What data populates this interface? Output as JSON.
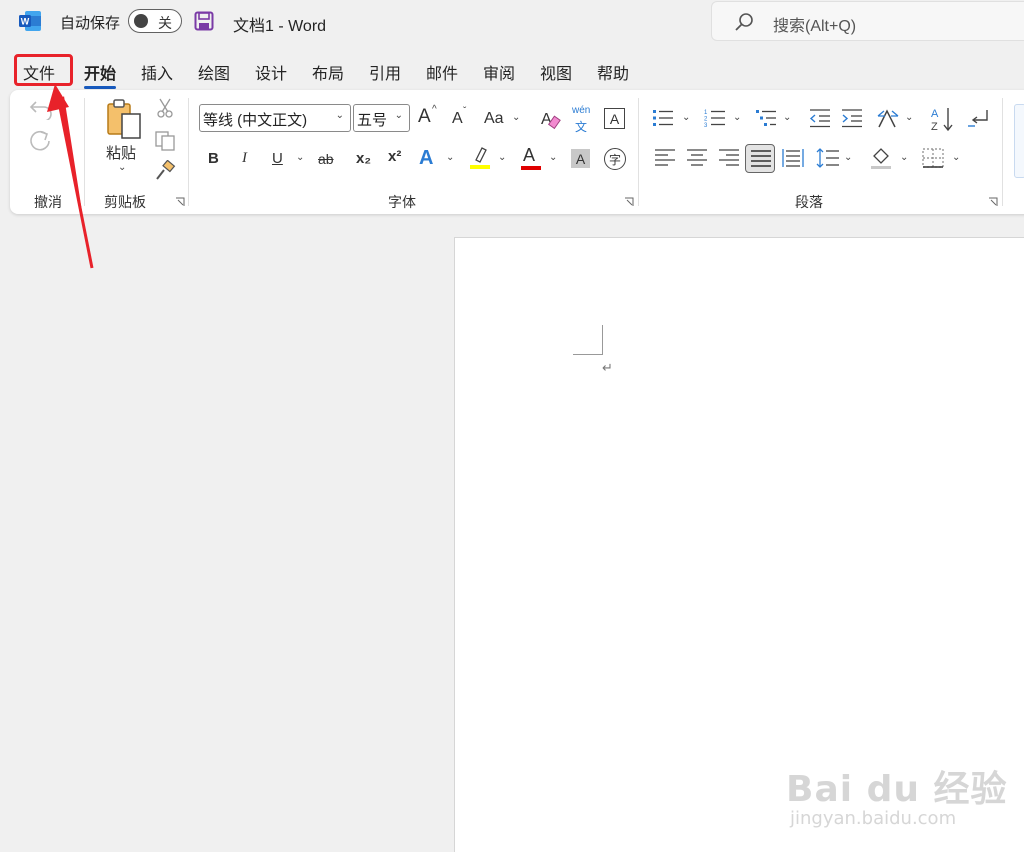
{
  "titlebar": {
    "autosave_label": "自动保存",
    "autosave_state": "关",
    "doc_title": "文档1  -  Word",
    "search_placeholder": "搜索(Alt+Q)"
  },
  "tabs": [
    "文件",
    "开始",
    "插入",
    "绘图",
    "设计",
    "布局",
    "引用",
    "邮件",
    "审阅",
    "视图",
    "帮助"
  ],
  "active_tab": "开始",
  "highlighted_tab": "文件",
  "ribbon": {
    "undo_group_label": "撤消",
    "clipboard": {
      "paste_label": "粘贴",
      "group_label": "剪贴板"
    },
    "font": {
      "font_name": "等线 (中文正文)",
      "font_size": "五号",
      "group_label": "字体",
      "bold": "B",
      "italic": "I",
      "underline": "U",
      "strike": "ab",
      "subscript": "x₂",
      "superscript": "x²",
      "case": "Aa",
      "grow": "A",
      "shrink": "A",
      "effects": "A",
      "phonetic_top": "wén",
      "phonetic_bottom": "文",
      "border_char": "A",
      "shading_char": "A",
      "enclose_char": "字",
      "highlight_color": "#ffff00",
      "font_color": "#e00000"
    },
    "paragraph": {
      "group_label": "段落",
      "sort_label": "A↓Z"
    }
  },
  "document": {
    "paragraph_mark": "↵"
  },
  "annotation": {
    "color": "#e8222a"
  },
  "watermark": {
    "main": "Bai du 经验",
    "sub": "jingyan.baidu.com"
  },
  "colors": {
    "accent": "#185abd",
    "word_blue": "#185abd",
    "save_purple": "#7a3aa6"
  }
}
